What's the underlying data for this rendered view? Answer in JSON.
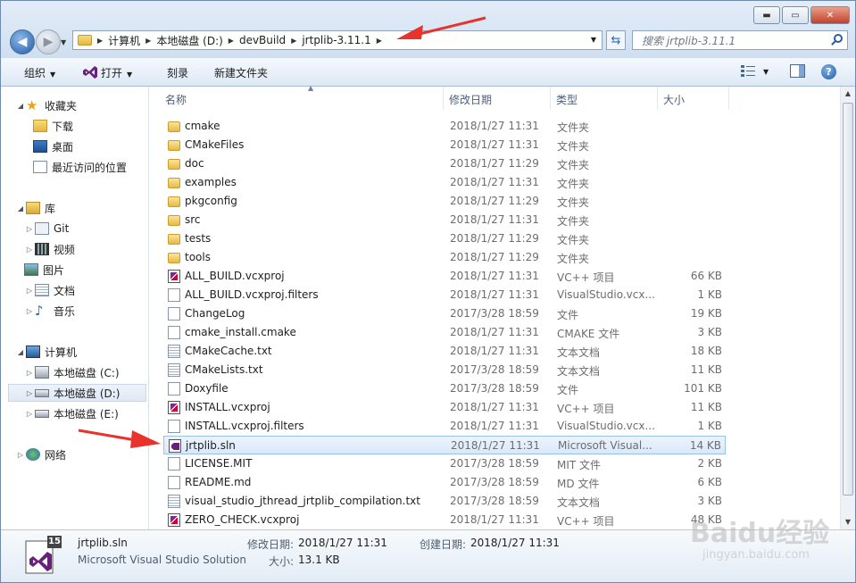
{
  "window": {
    "controls": {
      "minimize": "▬",
      "maximize": "▭",
      "close": "✕"
    }
  },
  "address": {
    "crumbs": [
      "计算机",
      "本地磁盘 (D:)",
      "devBuild",
      "jrtplib-3.11.1"
    ]
  },
  "search": {
    "placeholder": "搜索 jrtplib-3.11.1"
  },
  "toolbar": {
    "organize": "组织",
    "open": "打开",
    "burn": "刻录",
    "new_folder": "新建文件夹",
    "help": "?"
  },
  "sidebar": {
    "favorites": {
      "label": "收藏夹",
      "items": [
        "下载",
        "桌面",
        "最近访问的位置"
      ]
    },
    "libraries": {
      "label": "库",
      "items": [
        "Git",
        "视频",
        "图片",
        "文档",
        "音乐"
      ]
    },
    "computer": {
      "label": "计算机",
      "items": [
        "本地磁盘 (C:)",
        "本地磁盘 (D:)",
        "本地磁盘 (E:)"
      ]
    },
    "network": {
      "label": "网络"
    }
  },
  "columns": {
    "name": "名称",
    "date": "修改日期",
    "type": "类型",
    "size": "大小"
  },
  "files": [
    {
      "name": "cmake",
      "date": "2018/1/27 11:31",
      "type": "文件夹",
      "size": "",
      "icon": "folder"
    },
    {
      "name": "CMakeFiles",
      "date": "2018/1/27 11:31",
      "type": "文件夹",
      "size": "",
      "icon": "folder"
    },
    {
      "name": "doc",
      "date": "2018/1/27 11:29",
      "type": "文件夹",
      "size": "",
      "icon": "folder"
    },
    {
      "name": "examples",
      "date": "2018/1/27 11:31",
      "type": "文件夹",
      "size": "",
      "icon": "folder"
    },
    {
      "name": "pkgconfig",
      "date": "2018/1/27 11:29",
      "type": "文件夹",
      "size": "",
      "icon": "folder"
    },
    {
      "name": "src",
      "date": "2018/1/27 11:31",
      "type": "文件夹",
      "size": "",
      "icon": "folder"
    },
    {
      "name": "tests",
      "date": "2018/1/27 11:29",
      "type": "文件夹",
      "size": "",
      "icon": "folder"
    },
    {
      "name": "tools",
      "date": "2018/1/27 11:29",
      "type": "文件夹",
      "size": "",
      "icon": "folder"
    },
    {
      "name": "ALL_BUILD.vcxproj",
      "date": "2018/1/27 11:31",
      "type": "VC++ 项目",
      "size": "66 KB",
      "icon": "proj"
    },
    {
      "name": "ALL_BUILD.vcxproj.filters",
      "date": "2018/1/27 11:31",
      "type": "VisualStudio.vcx...",
      "size": "1 KB",
      "icon": "doc"
    },
    {
      "name": "ChangeLog",
      "date": "2017/3/28 18:59",
      "type": "文件",
      "size": "19 KB",
      "icon": "doc"
    },
    {
      "name": "cmake_install.cmake",
      "date": "2018/1/27 11:31",
      "type": "CMAKE 文件",
      "size": "3 KB",
      "icon": "doc"
    },
    {
      "name": "CMakeCache.txt",
      "date": "2018/1/27 11:31",
      "type": "文本文档",
      "size": "18 KB",
      "icon": "txt"
    },
    {
      "name": "CMakeLists.txt",
      "date": "2017/3/28 18:59",
      "type": "文本文档",
      "size": "11 KB",
      "icon": "txt"
    },
    {
      "name": "Doxyfile",
      "date": "2017/3/28 18:59",
      "type": "文件",
      "size": "101 KB",
      "icon": "doc"
    },
    {
      "name": "INSTALL.vcxproj",
      "date": "2018/1/27 11:31",
      "type": "VC++ 项目",
      "size": "11 KB",
      "icon": "proj"
    },
    {
      "name": "INSTALL.vcxproj.filters",
      "date": "2018/1/27 11:31",
      "type": "VisualStudio.vcx...",
      "size": "1 KB",
      "icon": "doc"
    },
    {
      "name": "jrtplib.sln",
      "date": "2018/1/27 11:31",
      "type": "Microsoft Visual...",
      "size": "14 KB",
      "icon": "sln",
      "selected": true
    },
    {
      "name": "LICENSE.MIT",
      "date": "2017/3/28 18:59",
      "type": "MIT 文件",
      "size": "2 KB",
      "icon": "doc"
    },
    {
      "name": "README.md",
      "date": "2017/3/28 18:59",
      "type": "MD 文件",
      "size": "6 KB",
      "icon": "doc"
    },
    {
      "name": "visual_studio_jthread_jrtplib_compilation.txt",
      "date": "2017/3/28 18:59",
      "type": "文本文档",
      "size": "3 KB",
      "icon": "txt"
    },
    {
      "name": "ZERO_CHECK.vcxproj",
      "date": "2018/1/27 11:31",
      "type": "VC++ 项目",
      "size": "48 KB",
      "icon": "proj"
    }
  ],
  "details": {
    "name": "jrtplib.sln",
    "type": "Microsoft Visual Studio Solution",
    "modified_label": "修改日期:",
    "modified": "2018/1/27 11:31",
    "created_label": "创建日期:",
    "created": "2018/1/27 11:31",
    "size_label": "大小:",
    "size": "13.1 KB",
    "badge": "15"
  },
  "watermark": {
    "logo": "Baidu经验",
    "url": "jingyan.baidu.com"
  },
  "colors": {
    "selection": "#d9e8f9",
    "accent": "#1f5ea8",
    "arrow": "#e8322a"
  }
}
